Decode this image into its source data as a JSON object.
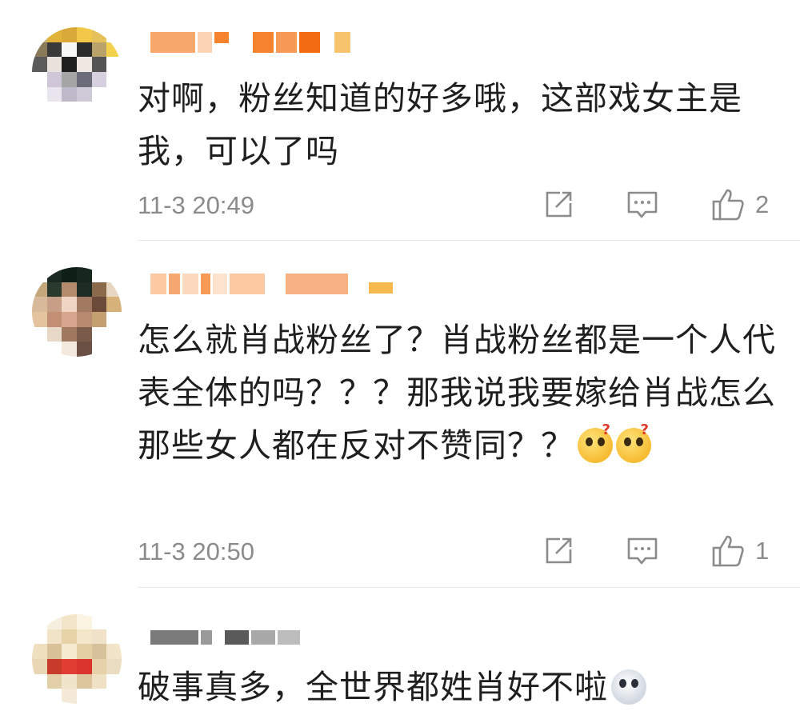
{
  "comments": [
    {
      "text": "对啊，粉丝知道的好多哦，这部戏女主是我，可以了吗",
      "time": "11-3 20:49",
      "likes": "2"
    },
    {
      "text": "怎么就肖战粉丝了？肖战粉丝都是一个人代表全体的吗？？？那我说我要嫁给肖战怎么那些女人都在反对不赞同？？",
      "emoji": [
        "?",
        "?"
      ],
      "time": "11-3 20:50",
      "likes": "1"
    },
    {
      "text": "破事真多，全世界都姓肖好不啦"
    }
  ],
  "icons": {
    "repost": "repost-icon",
    "comment": "comment-icon",
    "like": "thumbs-up-icon"
  },
  "colors": {
    "meta_gray": "#8b8b8b",
    "divider": "#eaeaea",
    "username_blur": "#f08a3a"
  }
}
